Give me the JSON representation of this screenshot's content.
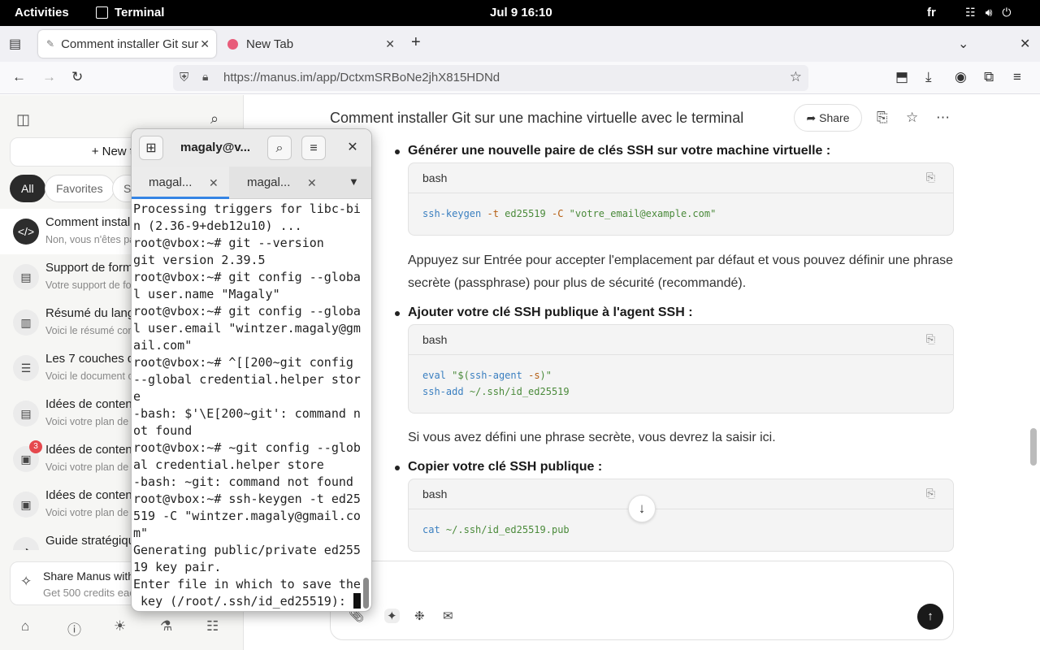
{
  "topbar": {
    "activities": "Activities",
    "app": "Terminal",
    "clock": "Jul 9  16:10",
    "lang": "fr"
  },
  "browser": {
    "tabs": [
      {
        "label": "Comment installer Git sur"
      },
      {
        "label": "New Tab"
      }
    ],
    "url": "https://manus.im/app/DctxmSRBoNe2jhX815HDNd"
  },
  "sidebar": {
    "new_task": "New task",
    "chips": [
      "All",
      "Favorites",
      "S"
    ],
    "tasks": [
      {
        "title": "Comment installer",
        "sub": "Non, vous n'êtes pa"
      },
      {
        "title": "Support de forma",
        "sub": "Votre support de for"
      },
      {
        "title": "Résumé du langa",
        "sub": "Voici le résumé com"
      },
      {
        "title": "Les 7 couches du",
        "sub": "Voici le document c"
      },
      {
        "title": "Idées de contenu",
        "sub": "Voici votre plan de"
      },
      {
        "title": "Idées de contenu",
        "sub": "Voici votre plan de",
        "badge": "3"
      },
      {
        "title": "Idées de contenu",
        "sub": "Voici votre plan de"
      },
      {
        "title": "Guide stratégique",
        "sub": ""
      }
    ],
    "share_title": "Share Manus with a",
    "share_sub": "Get 500 credits eac"
  },
  "main": {
    "title": "Comment installer Git sur une machine virtuelle avec le terminal",
    "share": "Share",
    "step1": "Générer une nouvelle paire de clés SSH sur votre machine virtuelle :",
    "code_lang": "bash",
    "para1": "Appuyez sur Entrée pour accepter l'emplacement par défaut et vous pouvez définir une phrase secrète (passphrase) pour plus de sécurité (recommandé).",
    "step2": "Ajouter votre clé SSH publique à l'agent SSH :",
    "para2": "Si vous avez défini une phrase secrète, vous devrez la saisir ici.",
    "step3": "Copier votre clé SSH publique :"
  },
  "terminal": {
    "title": "magaly@v...",
    "tabs": [
      "magal...",
      "magal..."
    ],
    "lines": [
      "Processing triggers for libc-bi",
      "n (2.36-9+deb12u10) ...",
      "root@vbox:~# git --version",
      "git version 2.39.5",
      "root@vbox:~# git config --globa",
      "l user.name \"Magaly\"",
      "root@vbox:~# git config --globa",
      "l user.email \"wintzer.magaly@gm",
      "ail.com\"",
      "root@vbox:~# ^[[200~git config ",
      "--global credential.helper store",
      "e",
      "-bash: $'\\E[200~git': command n",
      "ot found",
      "root@vbox:~# ~git config --glob",
      "al credential.helper store",
      "-bash: ~git: command not found",
      "root@vbox:~# ssh-keygen -t ed25",
      "519 -C \"wintzer.magaly@gmail.co",
      "m\"",
      "Generating public/private ed255",
      "19 key pair.",
      "Enter file in which to save the",
      " key (/root/.ssh/id_ed25519): "
    ]
  }
}
